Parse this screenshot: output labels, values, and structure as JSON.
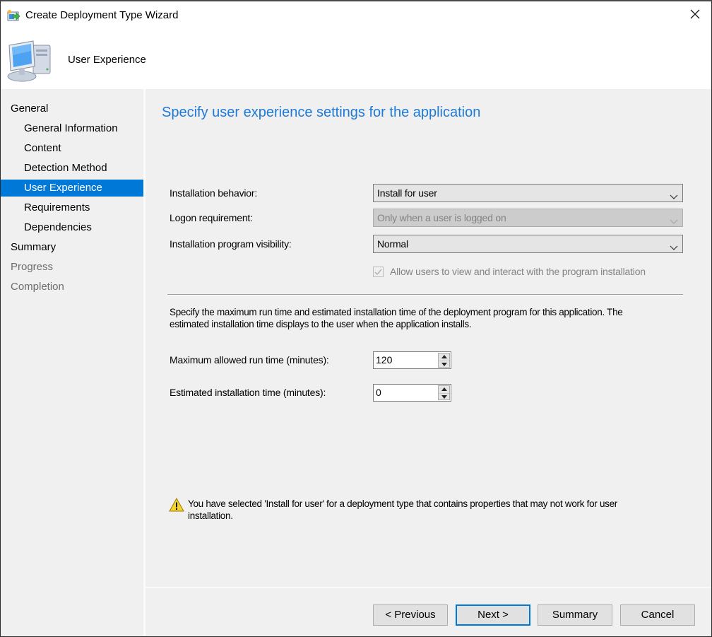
{
  "window": {
    "title": "Create Deployment Type Wizard",
    "close_icon": "close-icon"
  },
  "header": {
    "title": "User Experience",
    "icon": "computer-icon"
  },
  "sidebar": {
    "items": [
      {
        "label": "General",
        "level": 0,
        "state": "normal"
      },
      {
        "label": "General Information",
        "level": 1,
        "state": "normal"
      },
      {
        "label": "Content",
        "level": 1,
        "state": "normal"
      },
      {
        "label": "Detection Method",
        "level": 1,
        "state": "normal"
      },
      {
        "label": "User Experience",
        "level": 1,
        "state": "selected"
      },
      {
        "label": "Requirements",
        "level": 1,
        "state": "normal"
      },
      {
        "label": "Dependencies",
        "level": 1,
        "state": "normal"
      },
      {
        "label": "Summary",
        "level": 0,
        "state": "normal"
      },
      {
        "label": "Progress",
        "level": 0,
        "state": "disabled"
      },
      {
        "label": "Completion",
        "level": 0,
        "state": "disabled"
      }
    ],
    "selected_color": "#0078d7"
  },
  "main": {
    "page_title": "Specify user experience settings for the application",
    "title_color": "#1e7ad6",
    "installation_behavior": {
      "label": "Installation behavior:",
      "value": "Install for user"
    },
    "logon_requirement": {
      "label": "Logon requirement:",
      "value": "Only when a user is logged on",
      "disabled": true
    },
    "program_visibility": {
      "label": "Installation program visibility:",
      "value": "Normal"
    },
    "allow_interact": {
      "label": "Allow users to view and interact with the program installation",
      "checked": true,
      "disabled": true
    },
    "description": "Specify the maximum run time and estimated installation time of the deployment program for this application. The estimated installation time displays to the user when the application installs.",
    "max_run_time": {
      "label": "Maximum allowed run time (minutes):",
      "value": "120"
    },
    "estimated_time": {
      "label": "Estimated installation time (minutes):",
      "value": "0"
    },
    "warning": {
      "icon": "warning-icon",
      "text": "You have selected 'Install for user' for a deployment type that contains properties that may not work for user installation."
    }
  },
  "footer": {
    "previous_label": "< Previous",
    "next_label": "Next >",
    "summary_label": "Summary",
    "cancel_label": "Cancel"
  }
}
